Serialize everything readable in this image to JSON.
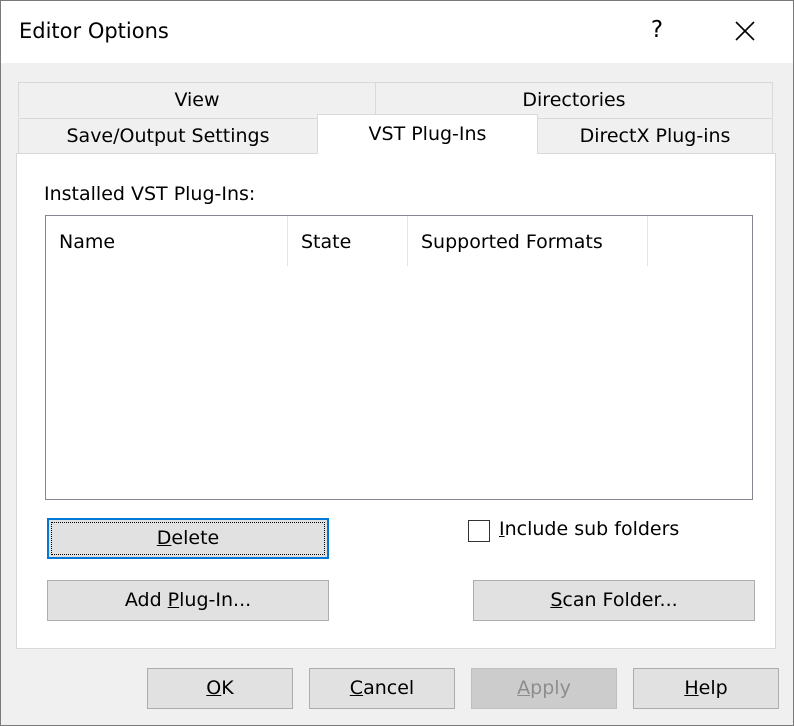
{
  "window": {
    "title": "Editor Options",
    "help_glyph": "?"
  },
  "tabs": {
    "row_back": [
      {
        "label": "View"
      },
      {
        "label": "Directories"
      }
    ],
    "row_front": [
      {
        "label": "Save/Output Settings"
      },
      {
        "label": "VST Plug-Ins",
        "active": true
      },
      {
        "label": "DirectX Plug-ins"
      }
    ]
  },
  "vst": {
    "installed_label": "Installed VST Plug-Ins:",
    "columns": [
      "Name",
      "State",
      "Supported Formats"
    ],
    "rows": [],
    "delete_button": {
      "mnemonic": "D",
      "rest": "elete"
    },
    "add_plugin_button": {
      "before": "Add ",
      "mnemonic": "P",
      "rest": "lug-In..."
    },
    "include_subfolders": {
      "mnemonic": "I",
      "rest": "nclude sub folders",
      "checked": false
    },
    "scan_folder_button": {
      "mnemonic": "S",
      "rest": "can Folder..."
    }
  },
  "footer": {
    "ok": {
      "mnemonic": "O",
      "rest": "K"
    },
    "cancel": {
      "mnemonic": "C",
      "rest": "ancel"
    },
    "apply": {
      "mnemonic": "A",
      "rest": "pply",
      "disabled": true
    },
    "help": {
      "mnemonic": "H",
      "rest": "elp"
    }
  },
  "colors": {
    "dialog_bg": "#f0f0f0",
    "focus_border": "#0078d7",
    "button_bg": "#e1e1e1"
  }
}
